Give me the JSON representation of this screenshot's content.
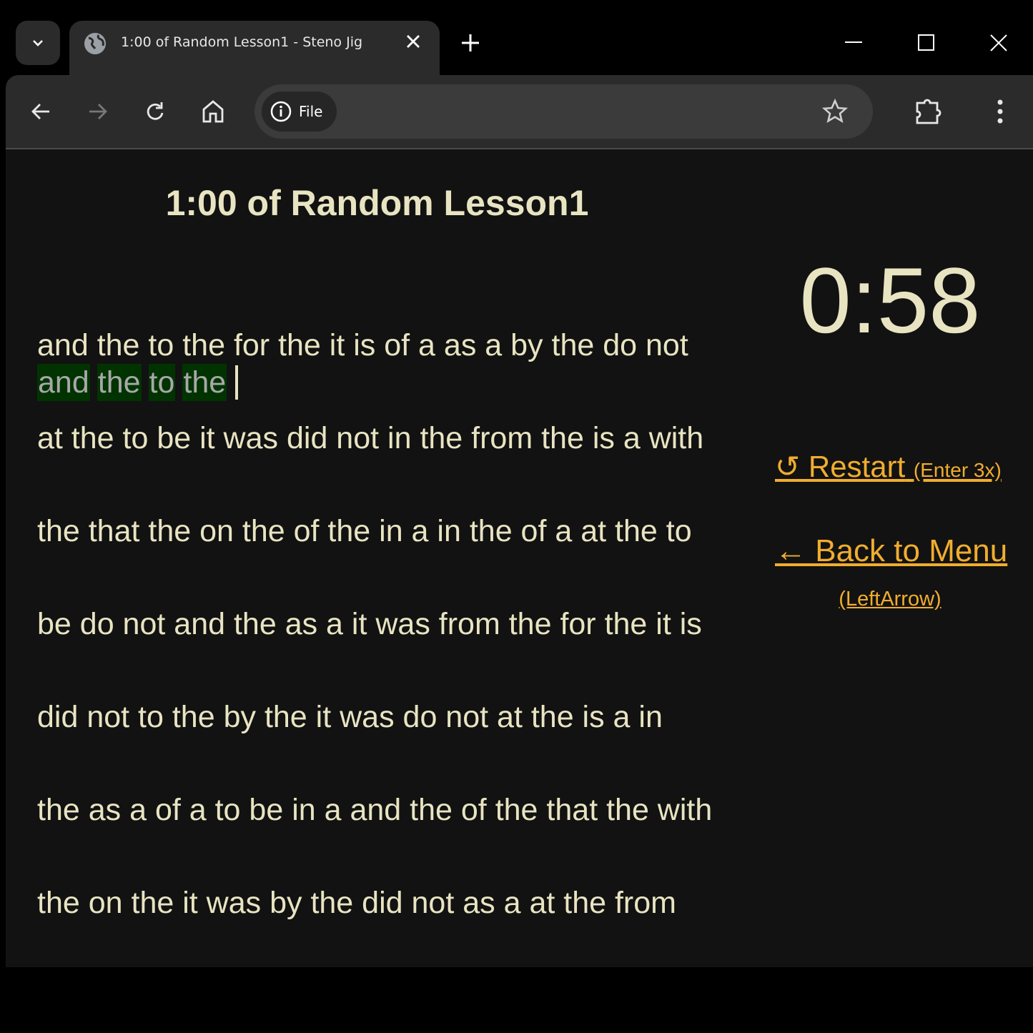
{
  "browser": {
    "tab_title": "1:00 of Random Lesson1 - Steno Jig",
    "address_chip": "File",
    "icons": [
      "chevron-down-icon",
      "globe-icon",
      "close-icon",
      "plus-icon",
      "minimize-icon",
      "maximize-icon",
      "window-close-icon",
      "back-arrow-icon",
      "forward-arrow-icon",
      "reload-icon",
      "home-icon",
      "info-icon",
      "star-icon",
      "puzzle-icon",
      "kebab-menu-icon"
    ]
  },
  "page": {
    "title": "1:00 of Random Lesson1",
    "timer": "0:58",
    "lines": [
      "and the to the for the it is of a as a by the do not",
      "at the to be it was did not in the from the is a with",
      "the that the on the of the in a in the of a at the to",
      "be do not and the as a it was from the for the it is",
      "did not to the by the it was do not at the is a in",
      "the as a of a to be in a and the of the that the with",
      "the on the it was by the did not as a at the from"
    ],
    "typed_words": [
      "and",
      "the",
      "to",
      "the"
    ],
    "restart": {
      "label": "↺ Restart",
      "hint": "(Enter 3x)"
    },
    "back": {
      "label": "← Back to Menu",
      "hint": "(LeftArrow)"
    },
    "colors": {
      "text": "#e8e4c2",
      "link": "#f0ad2e",
      "typed_bg": "#003300",
      "typed_text": "#a8a8a8",
      "background": "#121212"
    }
  }
}
